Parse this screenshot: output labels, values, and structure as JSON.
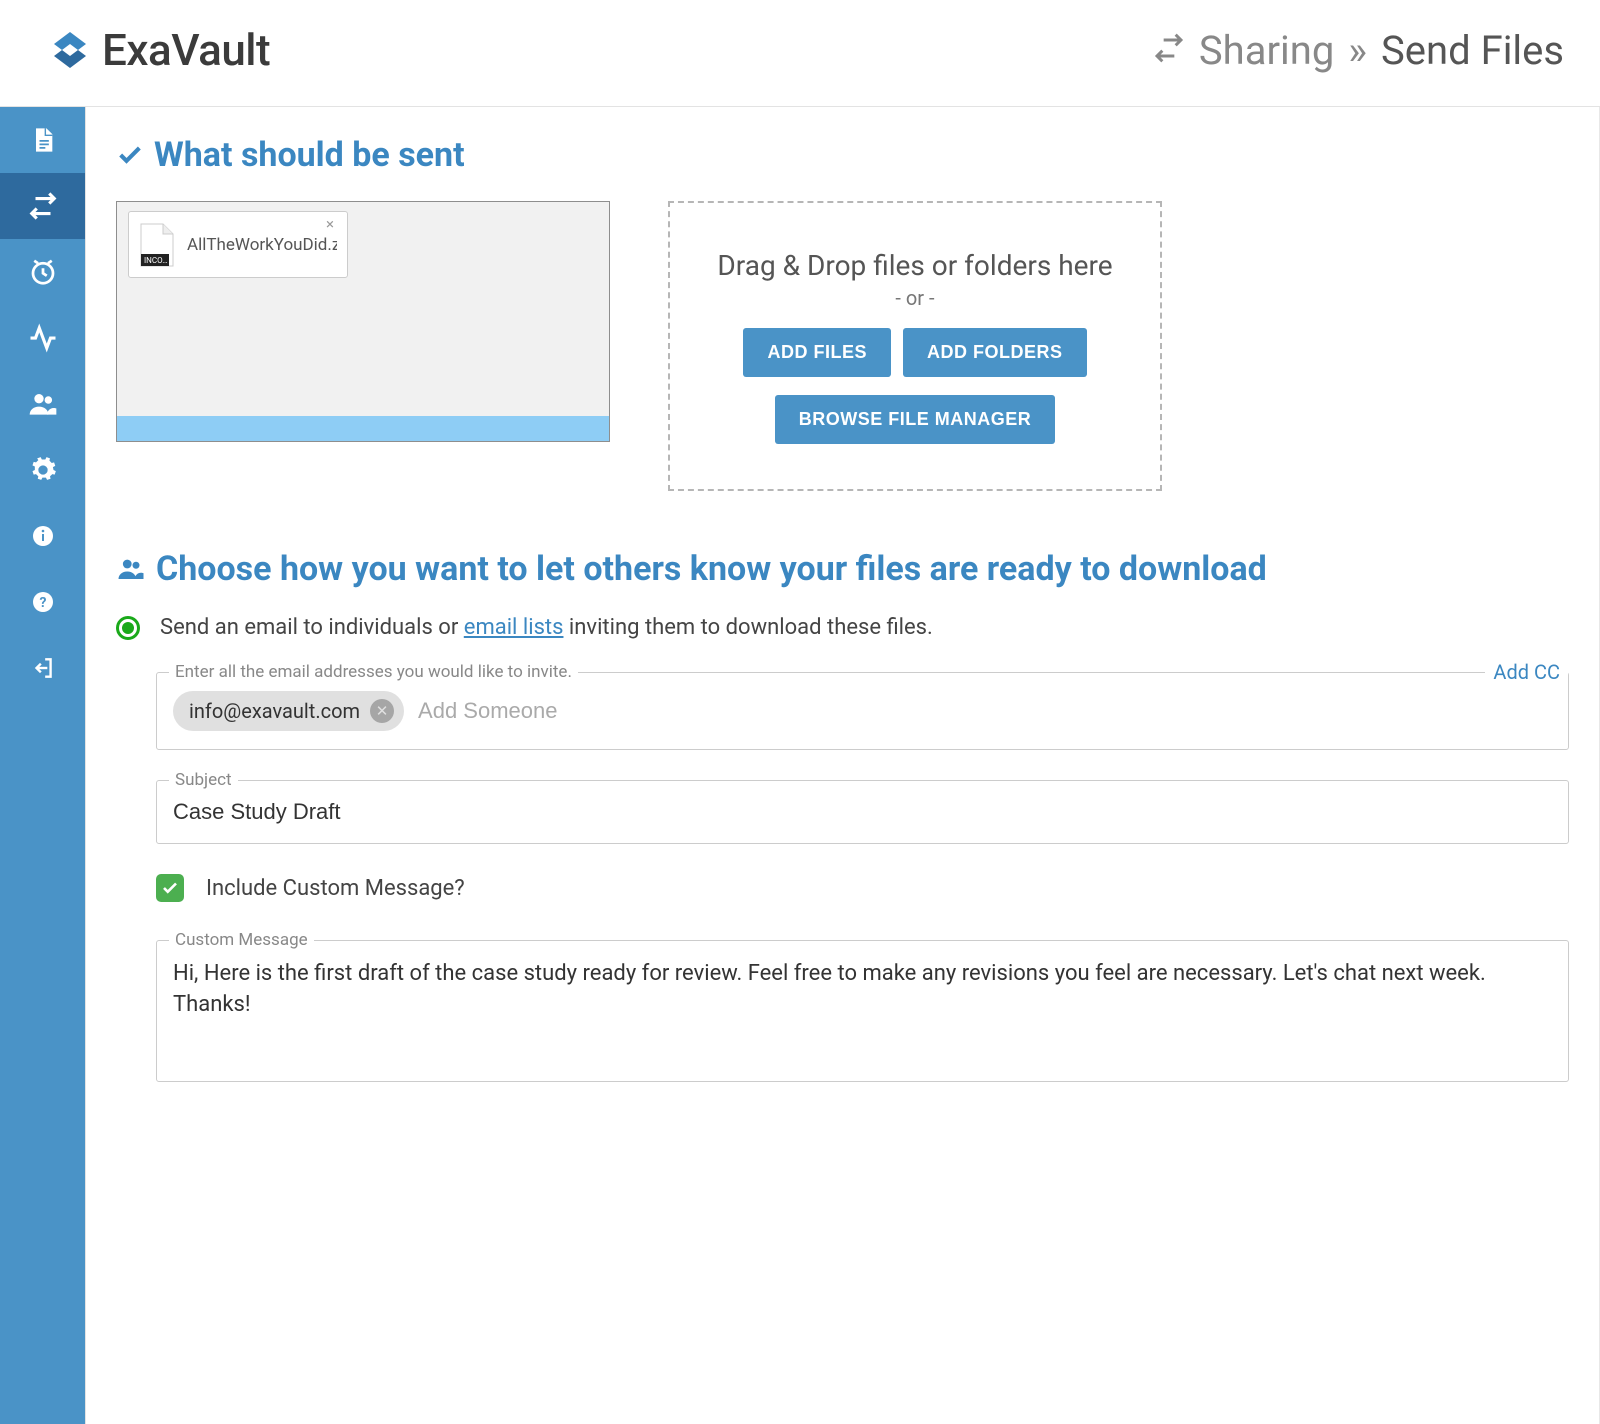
{
  "brand": "ExaVault",
  "breadcrumb": {
    "section": "Sharing",
    "page": "Send Files"
  },
  "sections": {
    "what_to_send": "What should be sent",
    "notify": "Choose how you want to let others know your files are ready to download"
  },
  "file": {
    "name": "AllTheWorkYouDid.zip.in",
    "badge": "INCO…"
  },
  "dropzone": {
    "title": "Drag & Drop files or folders here",
    "or": "- or -",
    "add_files": "ADD FILES",
    "add_folders": "ADD FOLDERS",
    "browse": "BROWSE FILE MANAGER"
  },
  "radio_text": {
    "prefix": "Send an email to individuals or ",
    "link": "email lists",
    "suffix": " inviting them to download these files."
  },
  "form": {
    "emails_legend": "Enter all the email addresses you would like to invite.",
    "add_cc": "Add CC",
    "chip_email": "info@exavault.com",
    "add_someone_placeholder": "Add Someone",
    "subject_legend": "Subject",
    "subject_value": "Case Study Draft",
    "include_custom": "Include Custom Message?",
    "custom_legend": "Custom Message",
    "custom_value": "Hi, Here is the first draft of the case study ready for review. Feel free to make any revisions you feel are necessary. Let's chat next week.\nThanks!"
  }
}
